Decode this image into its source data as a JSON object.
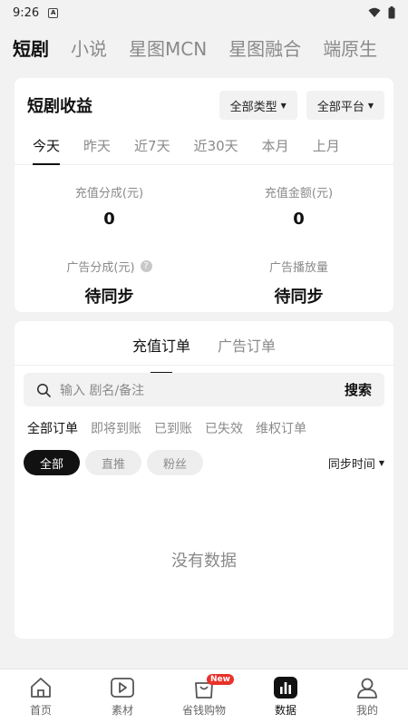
{
  "status_bar": {
    "time": "9:26",
    "notification_icon": "A",
    "icons": [
      "wifi-icon",
      "battery-icon"
    ]
  },
  "top_nav": {
    "tabs": [
      "短剧",
      "小说",
      "星图MCN",
      "星图融合",
      "端原生"
    ],
    "active_index": 0
  },
  "earnings": {
    "title": "短剧收益",
    "type_filter": "全部类型",
    "platform_filter": "全部平台",
    "ranges": [
      "今天",
      "昨天",
      "近7天",
      "近30天",
      "本月",
      "上月"
    ],
    "active_range": 0,
    "metrics": [
      {
        "label": "充值分成(元)",
        "value": "0"
      },
      {
        "label": "充值金额(元)",
        "value": "0"
      },
      {
        "label": "广告分成(元)",
        "value": "待同步",
        "help_icon": "?"
      },
      {
        "label": "广告播放量",
        "value": "待同步"
      }
    ]
  },
  "orders": {
    "tabs": [
      "充值订单",
      "广告订单"
    ],
    "active_tab": 0,
    "search": {
      "placeholder": "输入 剧名/备注",
      "button": "搜索"
    },
    "status_filters": [
      "全部订单",
      "即将到账",
      "已到账",
      "已失效",
      "维权订单"
    ],
    "active_status": 0,
    "pills": [
      "全部",
      "直推",
      "粉丝"
    ],
    "active_pill": 0,
    "sort_label": "同步时间",
    "empty_text": "没有数据"
  },
  "bottom_nav": {
    "items": [
      {
        "label": "首页",
        "icon": "home-icon"
      },
      {
        "label": "素材",
        "icon": "play-icon"
      },
      {
        "label": "省钱购物",
        "icon": "shopping-bag-icon",
        "badge": "New"
      },
      {
        "label": "数据",
        "icon": "chart-icon"
      },
      {
        "label": "我的",
        "icon": "profile-icon"
      }
    ],
    "active_index": 3
  },
  "colors": {
    "accent": "#111111",
    "badge": "#e8322b",
    "muted": "#8a8a8a",
    "background": "#f2f2f2"
  }
}
